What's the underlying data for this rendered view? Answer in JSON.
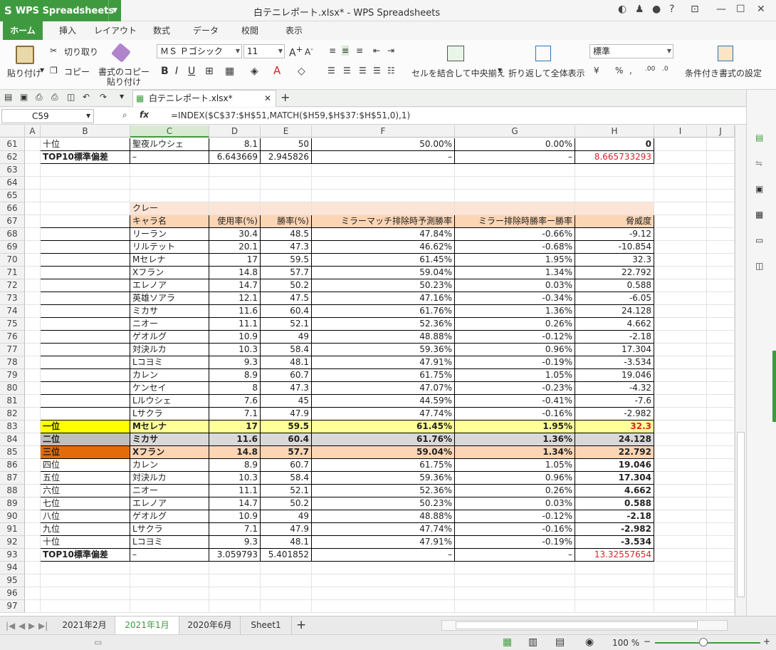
{
  "app": {
    "name": "WPS Spreadsheets",
    "window_title": "白テニレポート.xlsx* - WPS Spreadsheets"
  },
  "ribbon_tabs": [
    "ホーム",
    "挿入",
    "レイアウト",
    "数式",
    "データ",
    "校閲",
    "表示"
  ],
  "ribbon": {
    "paste": "貼り付け",
    "cut": "切り取り",
    "copy": "コピー",
    "format_painter_1": "書式のコピー",
    "format_painter_2": "貼り付け",
    "font_name": "ＭＳ Ｐゴシック",
    "font_size": "11",
    "merge_center": "セルを結合して中央揃え",
    "wrap_text": "折り返して全体表示",
    "number_format": "標準",
    "percent": "%",
    "cond_format": "条件付き書式の設定"
  },
  "file_tab": "白テニレポート.xlsx*",
  "formula": {
    "name_box": "C59",
    "fx": "fx",
    "text": "=INDEX($C$37:$H$51,MATCH($H59,$H$37:$H$51,0),1)"
  },
  "columns": [
    "A",
    "B",
    "C",
    "D",
    "E",
    "F",
    "G",
    "H",
    "I",
    "J"
  ],
  "rows": [
    {
      "n": "61",
      "b": "十位",
      "c": "聖夜ルウシェ",
      "d": "8.1",
      "e": "50",
      "f": "50.00%",
      "g": "0.00%",
      "h": "0"
    },
    {
      "n": "62",
      "b": "TOP10標準偏差",
      "c": "–",
      "d": "6.643669",
      "e": "2.945826",
      "f": "–",
      "g": "–",
      "h": "8.665733293"
    },
    {
      "n": "63"
    },
    {
      "n": "64"
    },
    {
      "n": "65"
    },
    {
      "n": "66",
      "c": "クレー"
    },
    {
      "n": "67",
      "c": "キャラ名",
      "d": "使用率(%)",
      "e": "勝率(%)",
      "f": "ミラーマッチ排除時予測勝率",
      "g": "ミラー排除時勝率ー勝率",
      "h": "脅威度"
    },
    {
      "n": "68",
      "c": "リーラン",
      "d": "30.4",
      "e": "48.5",
      "f": "47.84%",
      "g": "-0.66%",
      "h": "-9.12"
    },
    {
      "n": "69",
      "c": "リルテット",
      "d": "20.1",
      "e": "47.3",
      "f": "46.62%",
      "g": "-0.68%",
      "h": "-10.854"
    },
    {
      "n": "70",
      "c": "Mセレナ",
      "d": "17",
      "e": "59.5",
      "f": "61.45%",
      "g": "1.95%",
      "h": "32.3"
    },
    {
      "n": "71",
      "c": "Xフラン",
      "d": "14.8",
      "e": "57.7",
      "f": "59.04%",
      "g": "1.34%",
      "h": "22.792"
    },
    {
      "n": "72",
      "c": "エレノア",
      "d": "14.7",
      "e": "50.2",
      "f": "50.23%",
      "g": "0.03%",
      "h": "0.588"
    },
    {
      "n": "73",
      "c": "英雄ソアラ",
      "d": "12.1",
      "e": "47.5",
      "f": "47.16%",
      "g": "-0.34%",
      "h": "-6.05"
    },
    {
      "n": "74",
      "c": "ミカサ",
      "d": "11.6",
      "e": "60.4",
      "f": "61.76%",
      "g": "1.36%",
      "h": "24.128"
    },
    {
      "n": "75",
      "c": "ニオー",
      "d": "11.1",
      "e": "52.1",
      "f": "52.36%",
      "g": "0.26%",
      "h": "4.662"
    },
    {
      "n": "76",
      "c": "ゲオルグ",
      "d": "10.9",
      "e": "49",
      "f": "48.88%",
      "g": "-0.12%",
      "h": "-2.18"
    },
    {
      "n": "77",
      "c": "対決ルカ",
      "d": "10.3",
      "e": "58.4",
      "f": "59.36%",
      "g": "0.96%",
      "h": "17.304"
    },
    {
      "n": "78",
      "c": "Lコヨミ",
      "d": "9.3",
      "e": "48.1",
      "f": "47.91%",
      "g": "-0.19%",
      "h": "-3.534"
    },
    {
      "n": "79",
      "c": "カレン",
      "d": "8.9",
      "e": "60.7",
      "f": "61.75%",
      "g": "1.05%",
      "h": "19.046"
    },
    {
      "n": "80",
      "c": "ケンセイ",
      "d": "8",
      "e": "47.3",
      "f": "47.07%",
      "g": "-0.23%",
      "h": "-4.32"
    },
    {
      "n": "81",
      "c": "Lルウシェ",
      "d": "7.6",
      "e": "45",
      "f": "44.59%",
      "g": "-0.41%",
      "h": "-7.6"
    },
    {
      "n": "82",
      "c": "Lサクラ",
      "d": "7.1",
      "e": "47.9",
      "f": "47.74%",
      "g": "-0.16%",
      "h": "-2.982"
    },
    {
      "n": "83",
      "b": "一位",
      "c": "Mセレナ",
      "d": "17",
      "e": "59.5",
      "f": "61.45%",
      "g": "1.95%",
      "h": "32.3"
    },
    {
      "n": "84",
      "b": "二位",
      "c": "ミカサ",
      "d": "11.6",
      "e": "60.4",
      "f": "61.76%",
      "g": "1.36%",
      "h": "24.128"
    },
    {
      "n": "85",
      "b": "三位",
      "c": "Xフラン",
      "d": "14.8",
      "e": "57.7",
      "f": "59.04%",
      "g": "1.34%",
      "h": "22.792"
    },
    {
      "n": "86",
      "b": "四位",
      "c": "カレン",
      "d": "8.9",
      "e": "60.7",
      "f": "61.75%",
      "g": "1.05%",
      "h": "19.046"
    },
    {
      "n": "87",
      "b": "五位",
      "c": "対決ルカ",
      "d": "10.3",
      "e": "58.4",
      "f": "59.36%",
      "g": "0.96%",
      "h": "17.304"
    },
    {
      "n": "88",
      "b": "六位",
      "c": "ニオー",
      "d": "11.1",
      "e": "52.1",
      "f": "52.36%",
      "g": "0.26%",
      "h": "4.662"
    },
    {
      "n": "89",
      "b": "七位",
      "c": "エレノア",
      "d": "14.7",
      "e": "50.2",
      "f": "50.23%",
      "g": "0.03%",
      "h": "0.588"
    },
    {
      "n": "90",
      "b": "八位",
      "c": "ゲオルグ",
      "d": "10.9",
      "e": "49",
      "f": "48.88%",
      "g": "-0.12%",
      "h": "-2.18"
    },
    {
      "n": "91",
      "b": "九位",
      "c": "Lサクラ",
      "d": "7.1",
      "e": "47.9",
      "f": "47.74%",
      "g": "-0.16%",
      "h": "-2.982"
    },
    {
      "n": "92",
      "b": "十位",
      "c": "Lコヨミ",
      "d": "9.3",
      "e": "48.1",
      "f": "47.91%",
      "g": "-0.19%",
      "h": "-3.534"
    },
    {
      "n": "93",
      "b": "TOP10標準偏差",
      "c": "–",
      "d": "3.059793",
      "e": "5.401852",
      "f": "–",
      "g": "–",
      "h": "13.32557654"
    },
    {
      "n": "94"
    },
    {
      "n": "95"
    },
    {
      "n": "96"
    },
    {
      "n": "97"
    }
  ],
  "colors": {
    "first": "#ffff00",
    "second": "#bfbfbf",
    "third": "#e36c09",
    "header": "#fcd5b4",
    "title": "#fce4d6",
    "red": "#d6242c",
    "brand": "#3f9a3f"
  },
  "sheet_tabs": [
    "2021年2月",
    "2021年1月",
    "2020年6月",
    "Sheet1"
  ],
  "status": {
    "zoom": "100 %"
  }
}
